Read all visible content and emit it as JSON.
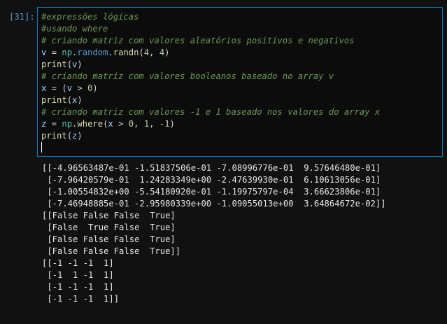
{
  "cell": {
    "prompt": "[31]:",
    "code_lines": [
      {
        "tokens": [
          {
            "cls": "cm",
            "text": "#expressões lógicas"
          }
        ]
      },
      {
        "tokens": [
          {
            "cls": "cm",
            "text": "#usando where"
          }
        ]
      },
      {
        "tokens": [
          {
            "cls": "cm",
            "text": "# criando matriz com valores aleatórios positivos e negativos"
          }
        ]
      },
      {
        "tokens": [
          {
            "cls": "var",
            "text": "v"
          },
          {
            "cls": "op",
            "text": " = "
          },
          {
            "cls": "mod",
            "text": "np"
          },
          {
            "cls": "punc",
            "text": "."
          },
          {
            "cls": "attr",
            "text": "random"
          },
          {
            "cls": "punc",
            "text": "."
          },
          {
            "cls": "fn",
            "text": "randn"
          },
          {
            "cls": "punc",
            "text": "("
          },
          {
            "cls": "num",
            "text": "4"
          },
          {
            "cls": "punc",
            "text": ", "
          },
          {
            "cls": "num",
            "text": "4"
          },
          {
            "cls": "punc",
            "text": ")"
          }
        ]
      },
      {
        "tokens": [
          {
            "cls": "fn",
            "text": "print"
          },
          {
            "cls": "punc",
            "text": "("
          },
          {
            "cls": "var",
            "text": "v"
          },
          {
            "cls": "punc",
            "text": ")"
          }
        ]
      },
      {
        "tokens": [
          {
            "cls": "cm",
            "text": "# criando matriz com valores booleanos baseado no array v"
          }
        ]
      },
      {
        "tokens": [
          {
            "cls": "var",
            "text": "x"
          },
          {
            "cls": "op",
            "text": " = "
          },
          {
            "cls": "punc",
            "text": "("
          },
          {
            "cls": "var",
            "text": "v"
          },
          {
            "cls": "op",
            "text": " > "
          },
          {
            "cls": "num",
            "text": "0"
          },
          {
            "cls": "punc",
            "text": ")"
          }
        ]
      },
      {
        "tokens": [
          {
            "cls": "fn",
            "text": "print"
          },
          {
            "cls": "punc",
            "text": "("
          },
          {
            "cls": "var",
            "text": "x"
          },
          {
            "cls": "punc",
            "text": ")"
          }
        ]
      },
      {
        "tokens": [
          {
            "cls": "cm",
            "text": "# criando matriz com valores -1 e 1 baseado nos valores do array x"
          }
        ]
      },
      {
        "tokens": [
          {
            "cls": "var",
            "text": "z"
          },
          {
            "cls": "op",
            "text": " = "
          },
          {
            "cls": "mod",
            "text": "np"
          },
          {
            "cls": "punc",
            "text": "."
          },
          {
            "cls": "fn",
            "text": "where"
          },
          {
            "cls": "punc",
            "text": "("
          },
          {
            "cls": "var",
            "text": "x"
          },
          {
            "cls": "op",
            "text": " > "
          },
          {
            "cls": "num",
            "text": "0"
          },
          {
            "cls": "punc",
            "text": ", "
          },
          {
            "cls": "num",
            "text": "1"
          },
          {
            "cls": "punc",
            "text": ", "
          },
          {
            "cls": "op",
            "text": "-"
          },
          {
            "cls": "num",
            "text": "1"
          },
          {
            "cls": "punc",
            "text": ")"
          }
        ]
      },
      {
        "tokens": [
          {
            "cls": "fn",
            "text": "print"
          },
          {
            "cls": "punc",
            "text": "("
          },
          {
            "cls": "var",
            "text": "z"
          },
          {
            "cls": "punc",
            "text": ")"
          }
        ]
      }
    ]
  },
  "output_lines": [
    "[[-4.96563487e-01 -1.51837506e-01 -7.08996776e-01  9.57646480e-01]",
    " [-7.96420579e-01  1.24283349e+00 -2.47639930e-01  6.10613056e-01]",
    " [-1.00554832e+00 -5.54180920e-01 -1.19975797e-04  3.66623806e-01]",
    " [-7.46948885e-01 -2.95980339e+00 -1.09055013e+00  3.64864672e-02]]",
    "[[False False False  True]",
    " [False  True False  True]",
    " [False False False  True]",
    " [False False False  True]]",
    "[[-1 -1 -1  1]",
    " [-1  1 -1  1]",
    " [-1 -1 -1  1]",
    " [-1 -1 -1  1]]"
  ]
}
